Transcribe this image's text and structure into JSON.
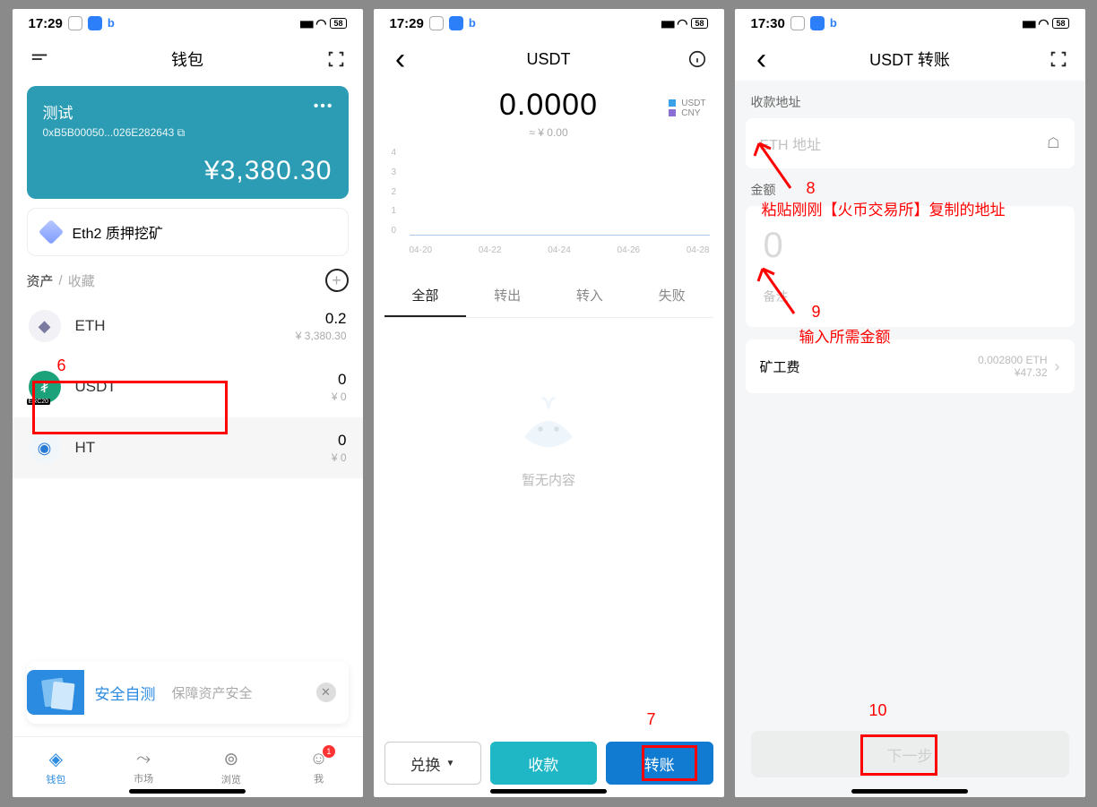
{
  "status": {
    "time1": "17:29",
    "time2": "17:29",
    "time3": "17:30",
    "battery": "58"
  },
  "screen1": {
    "title": "钱包",
    "wallet": {
      "name": "测试",
      "address": "0xB5B00050...026E282643",
      "balance_prefix": "¥",
      "balance": "3,380.30"
    },
    "stake": "Eth2 质押挖矿",
    "tabs": {
      "assets": "资产",
      "fav": "收藏"
    },
    "assets": [
      {
        "sym": "ETH",
        "amt": "0.2",
        "fiat": "¥ 3,380.30"
      },
      {
        "sym": "USDT",
        "amt": "0",
        "fiat": "¥ 0"
      },
      {
        "sym": "HT",
        "amt": "0",
        "fiat": "¥ 0"
      }
    ],
    "banner": {
      "title": "安全自测",
      "sub": "保障资产安全"
    },
    "nav": {
      "wallet": "钱包",
      "market": "市场",
      "browse": "浏览",
      "me": "我",
      "badge": "1"
    }
  },
  "screen2": {
    "title": "USDT",
    "balance": "0.0000",
    "approx": "≈ ¥ 0.00",
    "legend": {
      "a": "USDT",
      "b": "CNY"
    },
    "yticks": [
      "4",
      "3",
      "2",
      "1",
      "0"
    ],
    "xticks": [
      "04-20",
      "04-22",
      "04-24",
      "04-26",
      "04-28"
    ],
    "txtabs": {
      "all": "全部",
      "out": "转出",
      "in": "转入",
      "fail": "失败"
    },
    "empty": "暂无内容",
    "actions": {
      "exchange": "兑换",
      "receive": "收款",
      "send": "转账"
    }
  },
  "screen3": {
    "title": "USDT 转账",
    "addr_label": "收款地址",
    "addr_placeholder": "ETH 地址",
    "amount_label": "金额",
    "amount_placeholder": "0",
    "memo_placeholder": "备注",
    "fee_label": "矿工费",
    "fee_main": "0.002800 ETH",
    "fee_sub": "¥47.32",
    "next": "下一步"
  },
  "annotations": {
    "n6": "6",
    "n7": "7",
    "n8": "8",
    "n9": "9",
    "n10": "10",
    "note8": "粘贴刚刚【火币交易所】复制的地址",
    "note9": "输入所需金额"
  },
  "chart_data": {
    "type": "line",
    "title": "",
    "xlabel": "",
    "ylabel": "",
    "ylim": [
      0,
      4
    ],
    "x": [
      "04-20",
      "04-22",
      "04-24",
      "04-26",
      "04-28"
    ],
    "series": [
      {
        "name": "USDT",
        "values": [
          0,
          0,
          0,
          0,
          0
        ]
      },
      {
        "name": "CNY",
        "values": [
          0,
          0,
          0,
          0,
          0
        ]
      }
    ]
  }
}
